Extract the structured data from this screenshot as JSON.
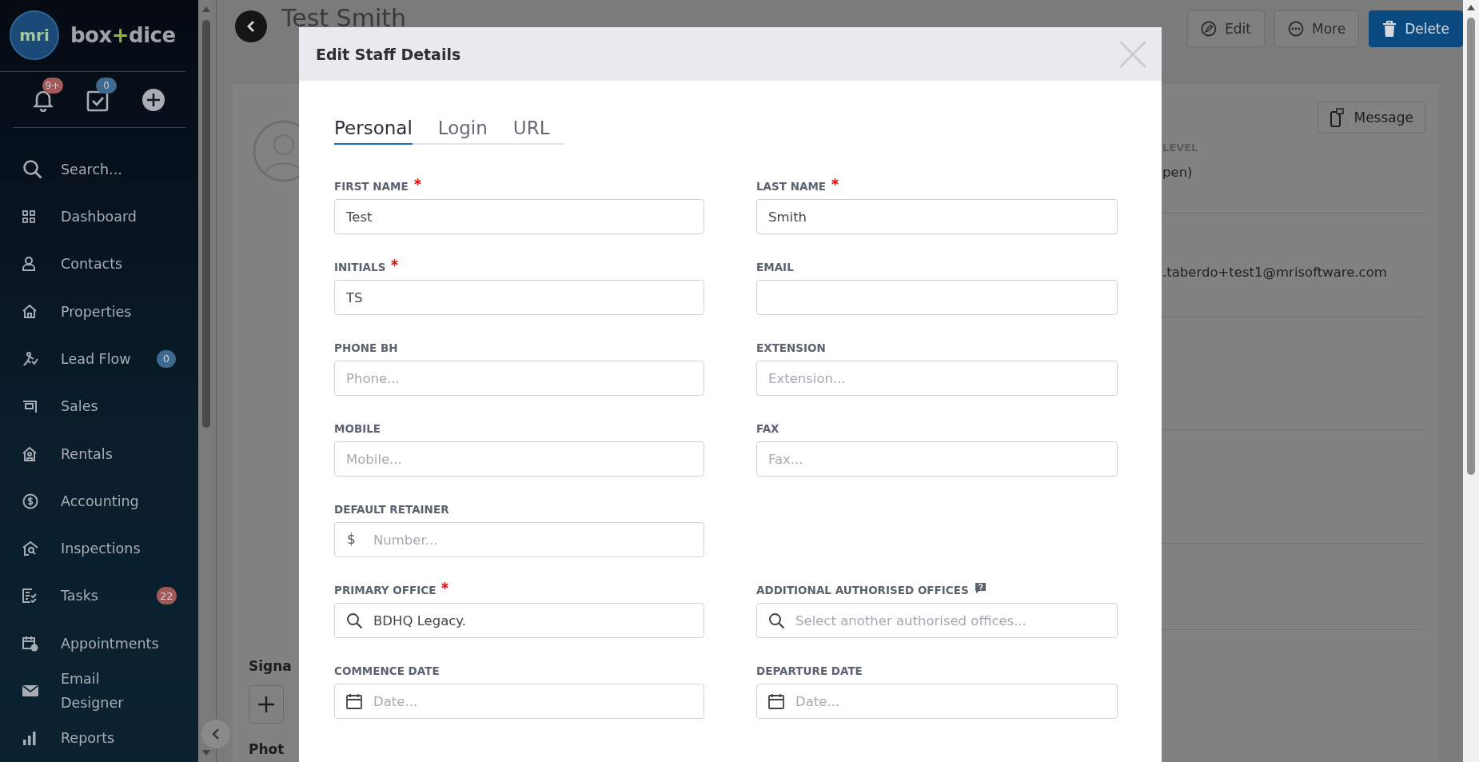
{
  "sidebar": {
    "logo_mark": "mri",
    "brand": [
      "box",
      "+",
      "dice"
    ],
    "quick_actions": [
      {
        "kind": "bell",
        "badge": {
          "text": "9+",
          "color": "#a05a5a"
        }
      },
      {
        "kind": "tasks",
        "badge": {
          "text": "0",
          "color": "#3e6a90"
        }
      },
      {
        "kind": "add"
      }
    ],
    "nav": [
      {
        "label": "Search..."
      },
      {
        "label": "Dashboard"
      },
      {
        "label": "Contacts"
      },
      {
        "label": "Properties"
      },
      {
        "label": "Lead Flow",
        "badge": {
          "text": "0",
          "color": "#3e6a90"
        }
      },
      {
        "label": "Sales"
      },
      {
        "label": "Rentals"
      },
      {
        "label": "Accounting"
      },
      {
        "label": "Inspections"
      },
      {
        "label": "Tasks",
        "badge": {
          "text": "22",
          "color": "#a05a5a"
        }
      },
      {
        "label": "Appointments"
      },
      {
        "label": "Email Designer"
      },
      {
        "label": "Reports"
      }
    ]
  },
  "page": {
    "title": "Test Smith",
    "actions": [
      {
        "kind": "edit",
        "label": "Edit"
      },
      {
        "kind": "more",
        "label": "More"
      },
      {
        "kind": "delete",
        "label": "Delete"
      }
    ],
    "message_button": "Message",
    "level_label": "LEVEL",
    "level_value": "pen)",
    "email_value": ".taberdo+test1@mrisoftware.com",
    "signature_heading": "Signa",
    "photo_heading": "Phot"
  },
  "modal": {
    "title": "Edit Staff Details",
    "tabs": [
      {
        "label": "Personal",
        "selected": true
      },
      {
        "label": "Login",
        "selected": false
      },
      {
        "label": "URL",
        "selected": false
      }
    ],
    "rows": [
      [
        {
          "label": "FIRST NAME",
          "required": true,
          "kind": "text",
          "value": "Test"
        },
        {
          "label": "LAST NAME",
          "required": true,
          "kind": "text",
          "value": "Smith"
        }
      ],
      [
        {
          "label": "INITIALS",
          "required": true,
          "kind": "text",
          "value": "TS"
        },
        {
          "label": "EMAIL",
          "required": false,
          "kind": "text"
        }
      ],
      [
        {
          "label": "PHONE BH",
          "required": false,
          "kind": "text",
          "placeholder": "Phone..."
        },
        {
          "label": "EXTENSION",
          "required": false,
          "kind": "text",
          "placeholder": "Extension..."
        }
      ],
      [
        {
          "label": "MOBILE",
          "required": false,
          "kind": "text",
          "placeholder": "Mobile..."
        },
        {
          "label": "FAX",
          "required": false,
          "kind": "text",
          "placeholder": "Fax..."
        }
      ],
      [
        {
          "label": "DEFAULT RETAINER",
          "required": false,
          "kind": "money",
          "prefix": "$",
          "placeholder": "Number..."
        }
      ],
      [
        {
          "label": "PRIMARY OFFICE",
          "required": true,
          "kind": "search",
          "value": "BDHQ Legacy."
        },
        {
          "label": "ADDITIONAL AUTHORISED OFFICES",
          "required": false,
          "help": true,
          "kind": "search",
          "placeholder": "Select another authorised offices..."
        }
      ],
      [
        {
          "label": "COMMENCE DATE",
          "required": false,
          "kind": "date",
          "placeholder": "Date..."
        },
        {
          "label": "DEPARTURE DATE",
          "required": false,
          "kind": "date",
          "placeholder": "Date..."
        }
      ]
    ]
  }
}
